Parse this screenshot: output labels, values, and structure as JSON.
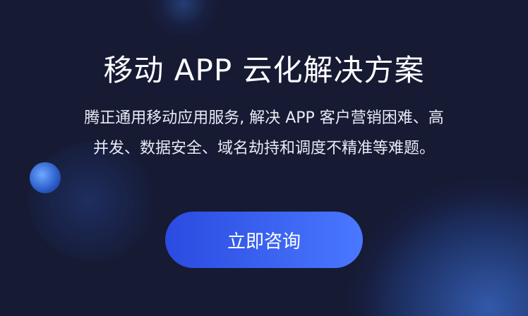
{
  "hero": {
    "title": "移动 APP 云化解决方案",
    "description_line1": "腾正通用移动应用服务, 解决 APP 客户营销困难、高",
    "description_line2": "并发、数据安全、域名劫持和调度不精准等难题。",
    "cta_label": "立即咨询"
  },
  "colors": {
    "background": "#161a33",
    "button_start": "#2a4be0",
    "button_end": "#4a78ff"
  }
}
